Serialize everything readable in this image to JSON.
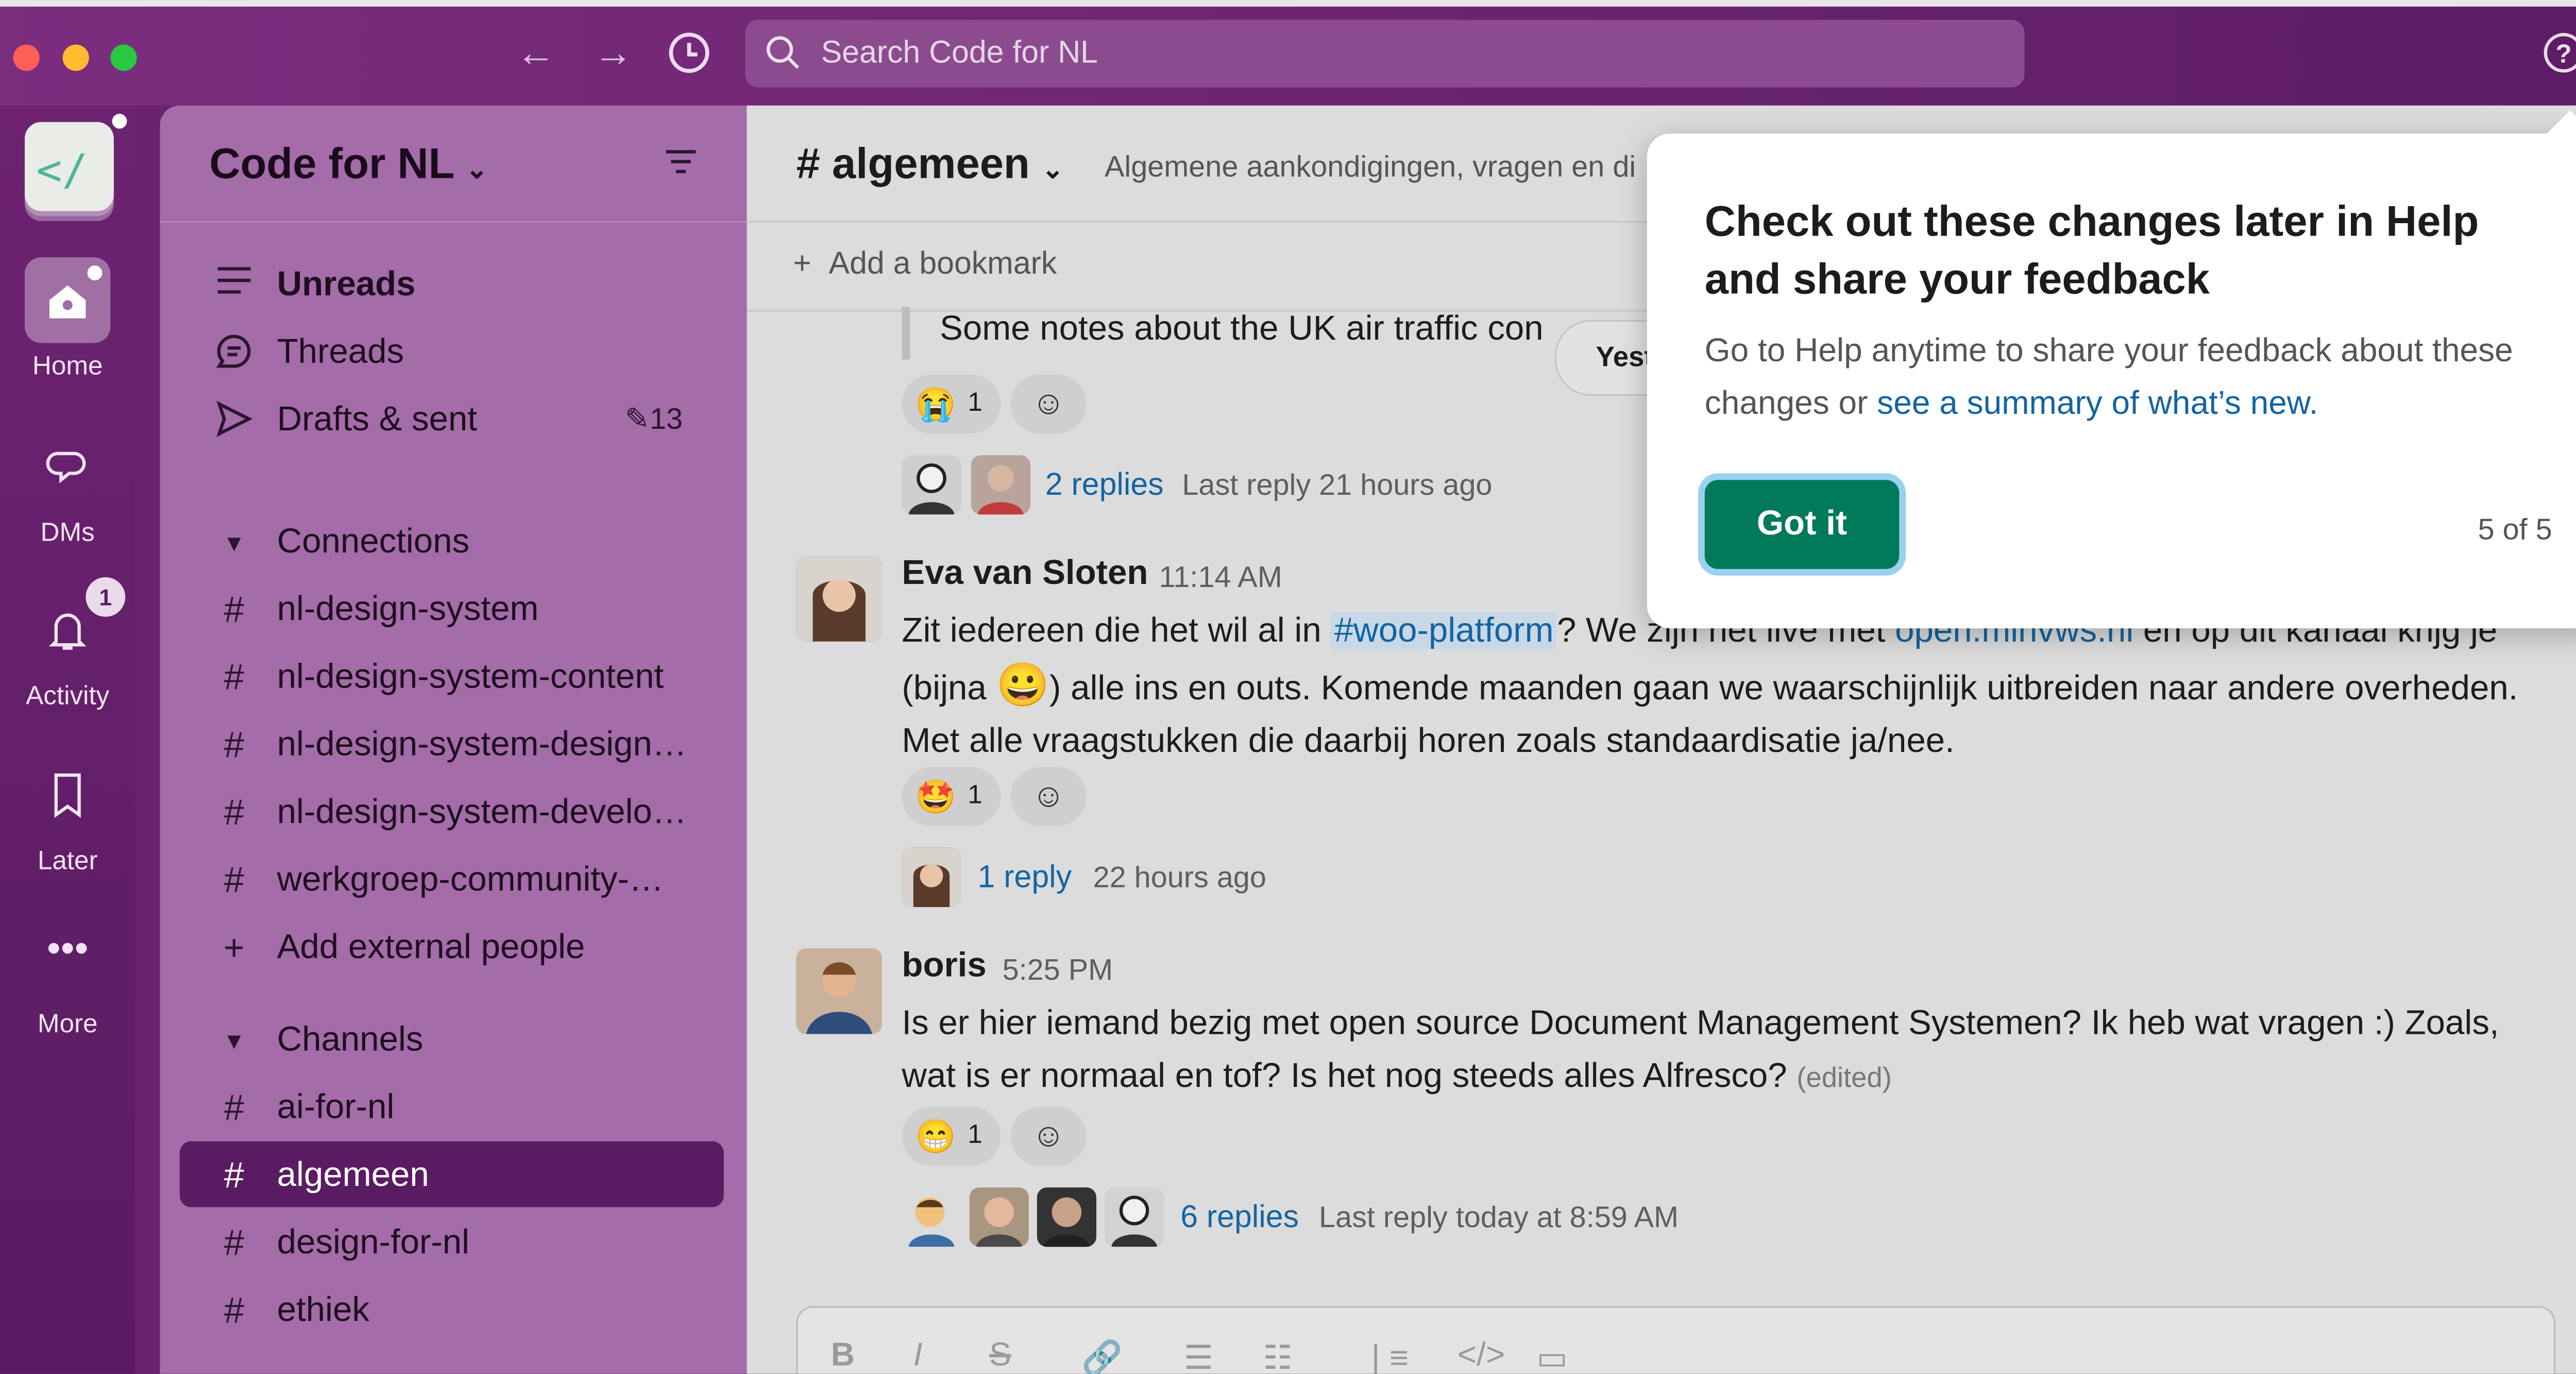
{
  "colors": {
    "rail": "#5a1b62",
    "sidebar": "#a46ca8",
    "selected": "#5a1b62",
    "accent_green": "#007a5a",
    "link": "#1264a3"
  },
  "search": {
    "placeholder": "Search Code for NL"
  },
  "rail": {
    "items": [
      {
        "label": "Home",
        "icon": "home-icon"
      },
      {
        "label": "DMs",
        "icon": "dms-icon"
      },
      {
        "label": "Activity",
        "icon": "bell-icon",
        "badge": "1"
      },
      {
        "label": "Later",
        "icon": "bookmark-icon"
      },
      {
        "label": "More",
        "icon": "more-icon"
      }
    ]
  },
  "sidebar": {
    "workspace": "Code for NL",
    "nav": [
      {
        "label": "Unreads",
        "icon": "unreads-icon"
      },
      {
        "label": "Threads",
        "icon": "threads-icon"
      },
      {
        "label": "Drafts & sent",
        "icon": "send-icon",
        "count": "13"
      }
    ],
    "sections": [
      {
        "title": "Connections",
        "items": [
          "nl-design-system",
          "nl-design-system-content",
          "nl-design-system-design…",
          "nl-design-system-develo…",
          "werkgroep-community-…"
        ],
        "extra": "Add external people"
      },
      {
        "title": "Channels",
        "items": [
          "ai-for-nl",
          "algemeen",
          "design-for-nl",
          "ethiek"
        ]
      }
    ],
    "selected": "algemeen"
  },
  "channel": {
    "name": "# algemeen",
    "topic": "Algemene aankondigingen, vragen en di",
    "bookmark": "Add a bookmark",
    "date_divider": "Yest"
  },
  "messages": [
    {
      "id": "m0",
      "quote": "Some notes about the UK air traffic con",
      "reaction": {
        "emoji": "😭",
        "count": "1"
      },
      "replies": "2 replies",
      "last_reply": "Last reply 21 hours ago"
    },
    {
      "id": "m1",
      "author": "Eva van Sloten",
      "time": "11:14 AM",
      "parts": [
        "Zit iedereen die het wil al in ",
        "#woo-platform",
        "? We zijn het live met ",
        "open.minvws.nl",
        " en op dit kanaal krijg je (bijna ",
        "😀",
        ") alle ins en outs. Komende maanden gaan we waarschijnlijk uitbreiden naar andere overheden. Met alle vraagstukken die daarbij horen zoals standaardisatie ja/nee."
      ],
      "reaction": {
        "emoji": "🤩",
        "count": "1"
      },
      "replies": "1 reply",
      "last_reply": "22 hours ago"
    },
    {
      "id": "m2",
      "author": "boris",
      "time": "5:25 PM",
      "text": "Is er hier iemand bezig met open source Document Management Systemen? Ik heb wat vragen :) Zoals, wat is er normaal en tof? Is het nog steeds alles Alfresco?",
      "edited": "(edited)",
      "reaction": {
        "emoji": "😁",
        "count": "1"
      },
      "replies": "6 replies",
      "last_reply": "Last reply today at 8:59 AM"
    }
  ],
  "popover": {
    "title": "Check out these changes later in Help and share your feedback",
    "body": "Go to Help anytime to share your feedback about these changes or ",
    "link": "see a summary of what’s new.",
    "button": "Got it",
    "step": "5 of 5"
  },
  "composer": {
    "buttons": [
      "B",
      "I",
      "S",
      "link",
      "ordered-list",
      "bullet-list",
      "quote",
      "code",
      "code-block"
    ]
  }
}
